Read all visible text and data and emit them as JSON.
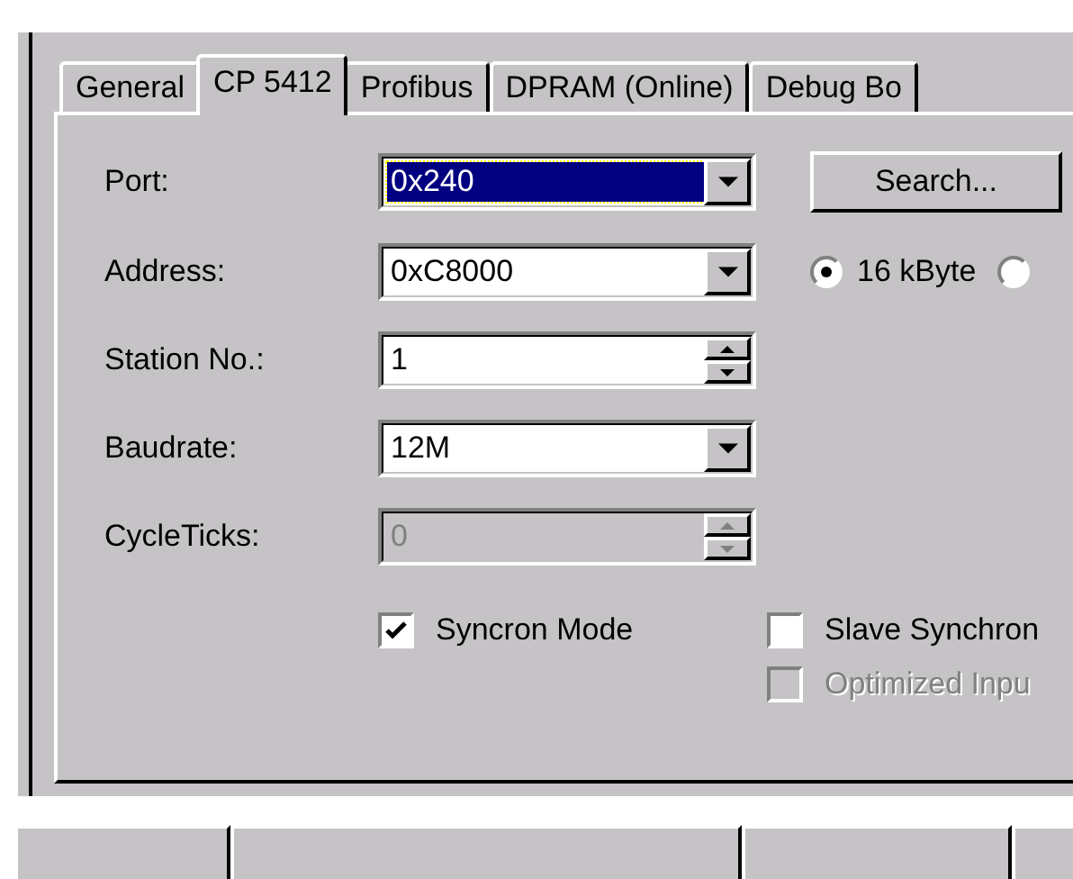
{
  "tabs": [
    {
      "label": "General",
      "selected": false
    },
    {
      "label": "CP 5412",
      "selected": true
    },
    {
      "label": "Profibus",
      "selected": false
    },
    {
      "label": "DPRAM (Online)",
      "selected": false
    },
    {
      "label": "Debug Bo",
      "selected": false
    }
  ],
  "fields": [
    {
      "kind": "combo",
      "label": "Port:",
      "value": "0x240",
      "focused": true,
      "disabled": false
    },
    {
      "kind": "combo",
      "label": "Address:",
      "value": "0xC8000",
      "focused": false,
      "disabled": false
    },
    {
      "kind": "spin",
      "label": "Station No.:",
      "value": "1",
      "focused": false,
      "disabled": false
    },
    {
      "kind": "combo",
      "label": "Baudrate:",
      "value": "12M",
      "focused": false,
      "disabled": false
    },
    {
      "kind": "spin",
      "label": "CycleTicks:",
      "value": "0",
      "focused": false,
      "disabled": true
    }
  ],
  "search_button": "Search...",
  "memory_radios": [
    {
      "label": "16 kByte",
      "selected": true
    },
    {
      "selected": false
    }
  ],
  "checkboxes": [
    {
      "label": "Syncron Mode",
      "checked": true,
      "disabled": false
    },
    {
      "label": "Slave Synchron",
      "checked": false,
      "disabled": false
    },
    {
      "label": "Optimized Inpu",
      "checked": false,
      "disabled": true
    }
  ]
}
